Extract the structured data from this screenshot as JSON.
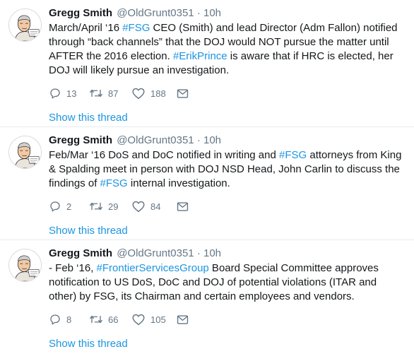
{
  "tweets": [
    {
      "name": "Gregg Smith",
      "handle": "@OldGrunt0351",
      "separator": "·",
      "time": "10h",
      "segments": [
        {
          "t": "March/April ‘16 ",
          "tag": false
        },
        {
          "t": "#FSG",
          "tag": true
        },
        {
          "t": " CEO (Smith) and lead Director (Adm Fallon) notified through “back channels” that the DOJ would NOT pursue the matter until AFTER the 2016 election. ",
          "tag": false
        },
        {
          "t": "#ErikPrince",
          "tag": true
        },
        {
          "t": " is aware that if HRC is elected, her  DOJ will likely pursue an investigation.",
          "tag": false
        }
      ],
      "replies": "13",
      "retweets": "87",
      "likes": "188",
      "show_thread": "Show this thread"
    },
    {
      "name": "Gregg Smith",
      "handle": "@OldGrunt0351",
      "separator": "·",
      "time": "10h",
      "segments": [
        {
          "t": "Feb/Mar ‘16 DoS and DoC notified in writing and ",
          "tag": false
        },
        {
          "t": "#FSG",
          "tag": true
        },
        {
          "t": " attorneys from King & Spalding meet in person with DOJ NSD Head, John Carlin to discuss the findings of ",
          "tag": false
        },
        {
          "t": "#FSG",
          "tag": true
        },
        {
          "t": " internal investigation.",
          "tag": false
        }
      ],
      "replies": "2",
      "retweets": "29",
      "likes": "84",
      "show_thread": "Show this thread"
    },
    {
      "name": "Gregg Smith",
      "handle": "@OldGrunt0351",
      "separator": "·",
      "time": "10h",
      "segments": [
        {
          "t": "- Feb ‘16, ",
          "tag": false
        },
        {
          "t": "#FrontierServicesGroup",
          "tag": true
        },
        {
          "t": " Board Special Committee approves notification to US DoS, DoC and DOJ of potential violations  (ITAR and other) by FSG, its Chairman and certain employees and vendors.",
          "tag": false
        }
      ],
      "replies": "8",
      "retweets": "66",
      "likes": "105",
      "show_thread": "Show this thread"
    }
  ],
  "colors": {
    "link": "#1b95e0",
    "muted": "#657786",
    "text": "#14171a"
  },
  "icons": [
    "reply-icon",
    "retweet-icon",
    "like-icon",
    "direct-message-icon"
  ]
}
